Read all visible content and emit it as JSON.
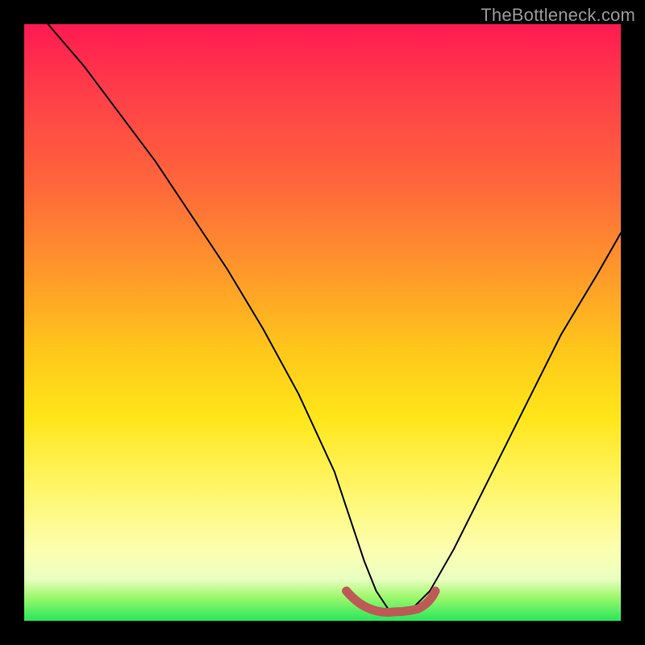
{
  "watermark": "TheBottleneck.com",
  "chart_data": {
    "type": "line",
    "title": "",
    "xlabel": "",
    "ylabel": "",
    "xlim": [
      0,
      100
    ],
    "ylim": [
      0,
      100
    ],
    "grid": false,
    "legend": false,
    "series": [
      {
        "name": "bottleneck-curve",
        "color": "#000000",
        "x": [
          4,
          10,
          16,
          22,
          28,
          34,
          40,
          46,
          52,
          55,
          57,
          59,
          61,
          63,
          65,
          68,
          72,
          78,
          84,
          90,
          96,
          100
        ],
        "values": [
          100,
          93,
          85,
          77,
          68,
          59,
          49,
          38,
          25,
          16,
          10,
          5,
          2,
          1,
          2,
          5,
          12,
          24,
          36,
          48,
          58,
          65
        ]
      },
      {
        "name": "valley-highlight",
        "color": "#bd5a56",
        "x": [
          54,
          56,
          58,
          60,
          62,
          64,
          66,
          68
        ],
        "values": [
          5,
          3,
          2,
          1.5,
          1.5,
          2,
          3,
          5
        ]
      }
    ],
    "background_gradient": {
      "top": "#ff1a52",
      "bottom": "#28e65a"
    }
  }
}
